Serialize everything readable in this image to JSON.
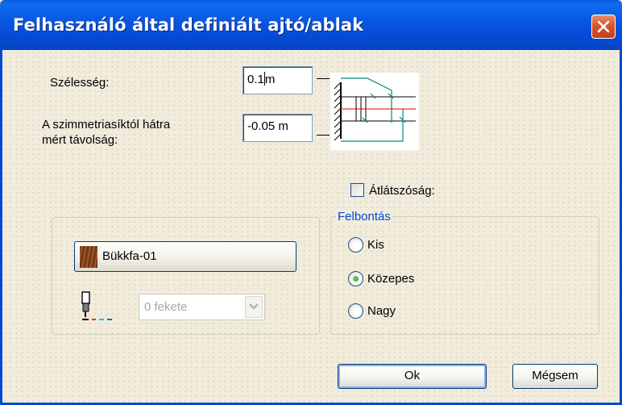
{
  "window": {
    "title": "Felhasználó által definiált ajtó/ablak"
  },
  "fields": {
    "width_label": "Szélesség:",
    "width_value": "0.1",
    "width_unit": "m",
    "distance_label_line1": "A szimmetriasíktól hátra",
    "distance_label_line2": "mért távolság:",
    "distance_value": "-0.05 m"
  },
  "transparency": {
    "label": "Átlátszóság:",
    "checked": false
  },
  "resolution": {
    "legend": "Felbontás",
    "options": [
      {
        "label": "Kis",
        "selected": false
      },
      {
        "label": "Közepes",
        "selected": true
      },
      {
        "label": "Nagy",
        "selected": false
      }
    ]
  },
  "material": {
    "label": "Bükkfa-01"
  },
  "pen": {
    "selected": "0 fekete",
    "enabled": false
  },
  "buttons": {
    "ok": "Ok",
    "cancel": "Mégsem"
  },
  "icons": [
    "close-icon",
    "door-window-diagram-icon",
    "wood-texture-swatch",
    "pen-icon",
    "chevron-down-icon"
  ],
  "colors": {
    "title_bar": "#0548d0",
    "group_legend": "#0046d5",
    "close_button": "#d8542c"
  }
}
